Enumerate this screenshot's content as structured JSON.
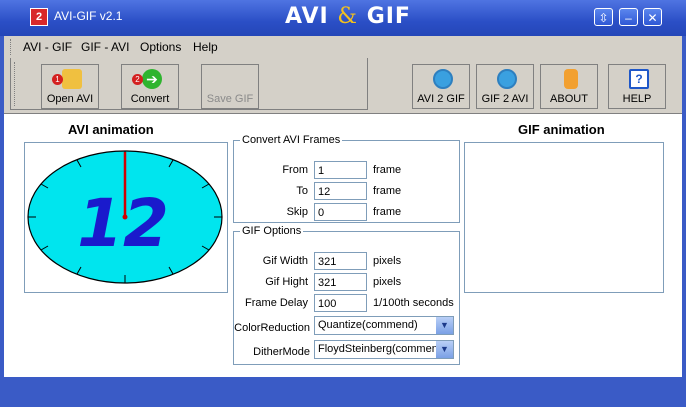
{
  "window": {
    "title": "AVI-GIF v2.1",
    "brand_left": "AVI",
    "brand_amp": "&",
    "brand_right": "GIF"
  },
  "titlebar_buttons": {
    "restore": "⇳",
    "minimize": "–",
    "close": "✕"
  },
  "menu": [
    "AVI - GIF",
    "GIF - AVI",
    "Options",
    "Help"
  ],
  "toolbar": {
    "open_avi": "Open AVI",
    "convert": "Convert",
    "save_gif": "Save GIF",
    "avi2gif": "AVI 2 GIF",
    "gif2avi": "GIF 2 AVI",
    "about": "ABOUT",
    "help": "HELP"
  },
  "avi_panel": {
    "title": "AVI  animation",
    "clock_number": "12"
  },
  "gif_panel": {
    "title": "GIF  animation"
  },
  "convert_frames": {
    "legend": "Convert AVI Frames",
    "from_label": "From",
    "from_value": "1",
    "from_unit": "frame",
    "to_label": "To",
    "to_value": "12",
    "to_unit": "frame",
    "skip_label": "Skip",
    "skip_value": "0",
    "skip_unit": "frame"
  },
  "gif_options": {
    "legend": "GIF Options",
    "width_label": "Gif Width",
    "width_value": "321",
    "width_unit": "pixels",
    "height_label": "Gif Hight",
    "height_value": "321",
    "height_unit": "pixels",
    "delay_label": "Frame Delay",
    "delay_value": "100",
    "delay_unit": "1/100th seconds",
    "color_label": "ColorReduction",
    "color_value": "Quantize(commend)",
    "dither_label": "DitherMode",
    "dither_value": "FloydSteinberg(commend"
  },
  "colors": {
    "titlebar": "#2b4fc6",
    "chrome": "#d4d0c8",
    "clock_face": "#00e5ee",
    "clock_digits": "#1a1acc",
    "clock_hand": "#d00000"
  }
}
